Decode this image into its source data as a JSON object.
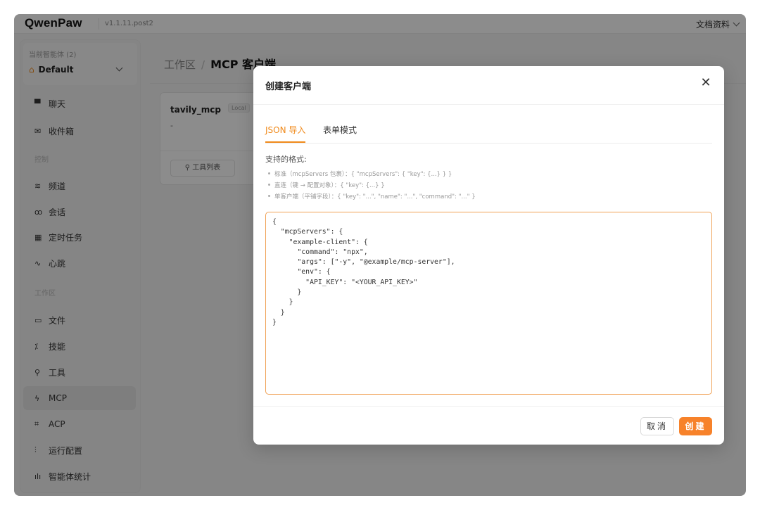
{
  "topbar": {
    "logo": "QwenPaw",
    "version": "v1.1.11.post2",
    "docs_label": "文档资料"
  },
  "sidebar": {
    "agent_label": "当前智能体 (2)",
    "agent_selected": "Default",
    "items": [
      {
        "label": "聊天",
        "icon": "chat-icon",
        "glyph": "▀"
      },
      {
        "label": "收件箱",
        "icon": "inbox-icon",
        "glyph": "✉"
      },
      {
        "label": "频道",
        "icon": "wifi-icon",
        "glyph": "≋"
      },
      {
        "label": "会话",
        "icon": "users-icon",
        "glyph": "ꝏ"
      },
      {
        "label": "定时任务",
        "icon": "calendar-icon",
        "glyph": "▦"
      },
      {
        "label": "心跳",
        "icon": "pulse-icon",
        "glyph": "∿"
      },
      {
        "label": "文件",
        "icon": "folder-icon",
        "glyph": "▭"
      },
      {
        "label": "技能",
        "icon": "skills-icon",
        "glyph": "⁒"
      },
      {
        "label": "工具",
        "icon": "wrench-icon",
        "glyph": "⚲"
      },
      {
        "label": "MCP",
        "icon": "mcp-icon",
        "glyph": "ϟ"
      },
      {
        "label": "ACP",
        "icon": "acp-icon",
        "glyph": "⌗"
      },
      {
        "label": "运行配置",
        "icon": "sliders-icon",
        "glyph": "⫶"
      },
      {
        "label": "智能体统计",
        "icon": "stats-icon",
        "glyph": "ılı"
      }
    ],
    "sections": {
      "control": "控制",
      "workspace": "工作区"
    }
  },
  "main": {
    "breadcrumb_root": "工作区",
    "breadcrumb_current": "MCP 客户端",
    "card": {
      "title": "tavily_mcp",
      "badge": "Local",
      "desc": "-",
      "tools_button": "工具列表"
    }
  },
  "modal": {
    "title": "创建客户端",
    "tabs": [
      "JSON 导入",
      "表单模式"
    ],
    "formats_title": "支持的格式:",
    "formats": [
      "标准（mcpServers 包裹）：{ \"mcpServers\": { \"key\": {...} } }",
      "直连（键 → 配置对象）：{ \"key\": {...} }",
      "单客户端（平铺字段）：{ \"key\": \"...\", \"name\": \"...\", \"command\": \"...\" }"
    ],
    "code": "{\n  \"mcpServers\": {\n    \"example-client\": {\n      \"command\": \"npx\",\n      \"args\": [\"-y\", \"@example/mcp-server\"],\n      \"env\": {\n        \"API_KEY\": \"<YOUR_API_KEY>\"\n      }\n    }\n  }\n}",
    "cancel_label": "取消",
    "create_label": "创建"
  },
  "colors": {
    "accent": "#f7822a",
    "overlay": "rgba(0,0,0,0.45)"
  }
}
